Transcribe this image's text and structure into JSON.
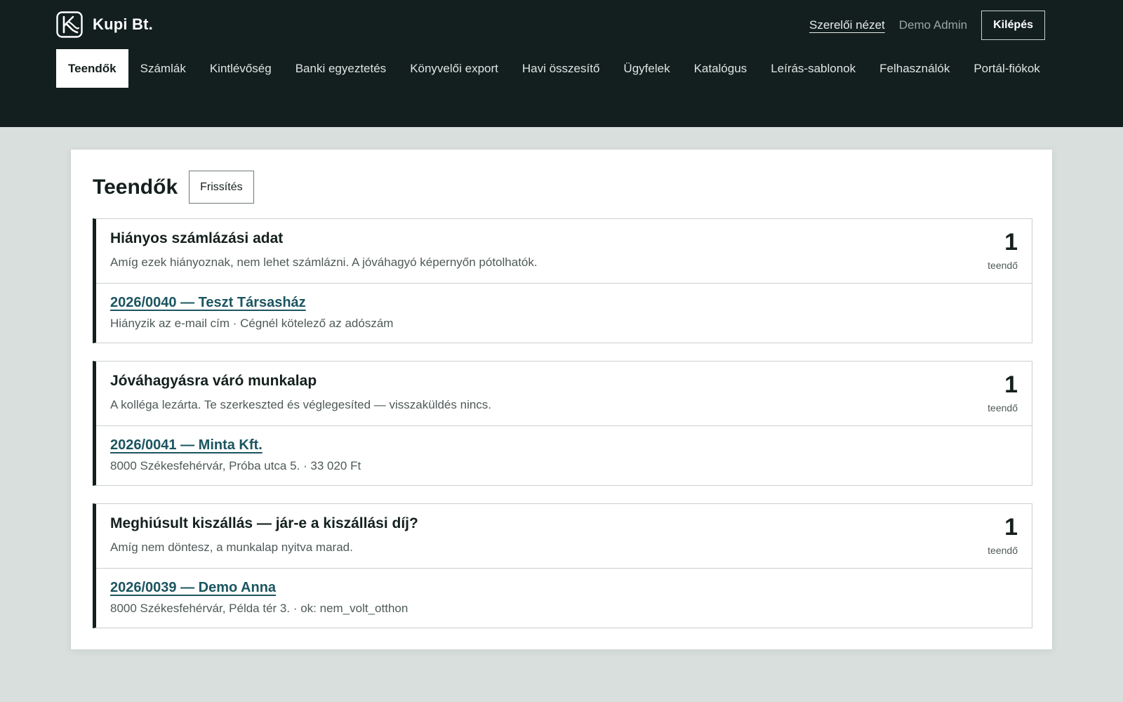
{
  "brand": {
    "name": "Kupi Bt.",
    "logo_icon": "k-logo-icon"
  },
  "header": {
    "mechanic_view": "Szerelői nézet",
    "user": "Demo Admin",
    "logout": "Kilépés"
  },
  "nav": {
    "items": [
      {
        "label": "Teendők",
        "active": true
      },
      {
        "label": "Számlák"
      },
      {
        "label": "Kintlévőség"
      },
      {
        "label": "Banki egyeztetés"
      },
      {
        "label": "Könyvelői export"
      },
      {
        "label": "Havi összesítő"
      },
      {
        "label": "Ügyfelek"
      },
      {
        "label": "Katalógus"
      },
      {
        "label": "Leírás-sablonok"
      },
      {
        "label": "Felhasználók"
      },
      {
        "label": "Portál-fiókok"
      }
    ]
  },
  "page": {
    "title": "Teendők",
    "refresh": "Frissítés"
  },
  "groups": [
    {
      "title": "Hiányos számlázási adat",
      "desc": "Amíg ezek hiányoznak, nem lehet számlázni. A jóváhagyó képernyőn pótolhatók.",
      "count": "1",
      "count_label": "teendő",
      "items": [
        {
          "link": "2026/0040 — Teszt Társasház",
          "detail": "Hiányzik az e-mail cím · Cégnél kötelező az adószám"
        }
      ]
    },
    {
      "title": "Jóváhagyásra váró munkalap",
      "desc": "A kolléga lezárta. Te szerkeszted és véglegesíted — visszaküldés nincs.",
      "count": "1",
      "count_label": "teendő",
      "items": [
        {
          "link": "2026/0041 — Minta Kft.",
          "detail": "8000 Székesfehérvár, Próba utca 5. · 33 020 Ft"
        }
      ]
    },
    {
      "title": "Meghiúsult kiszállás — jár-e a kiszállási díj?",
      "desc": "Amíg nem döntesz, a munkalap nyitva marad.",
      "count": "1",
      "count_label": "teendő",
      "items": [
        {
          "link": "2026/0039 — Demo Anna",
          "detail": "8000 Székesfehérvár, Példa tér 3. · ok: nem_volt_otthon"
        }
      ]
    }
  ]
}
